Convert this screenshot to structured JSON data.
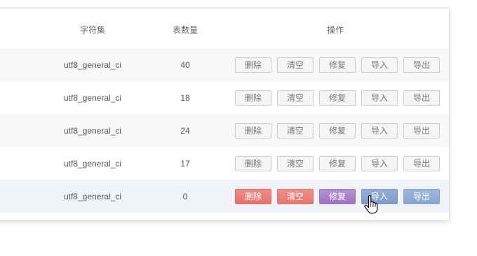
{
  "table": {
    "columns": {
      "charset": "字符集",
      "count": "表数量",
      "operations": "操作"
    },
    "rows": [
      {
        "charset": "utf8_general_ci",
        "count": "40"
      },
      {
        "charset": "utf8_general_ci",
        "count": "18"
      },
      {
        "charset": "utf8_general_ci",
        "count": "24"
      },
      {
        "charset": "utf8_general_ci",
        "count": "17"
      },
      {
        "charset": "utf8_general_ci",
        "count": "0"
      }
    ],
    "actions": {
      "delete": "删除",
      "clear": "清空",
      "repair": "修复",
      "import": "导入",
      "export": "导出"
    }
  },
  "cursor": {
    "icon": "hand-pointer-icon"
  }
}
